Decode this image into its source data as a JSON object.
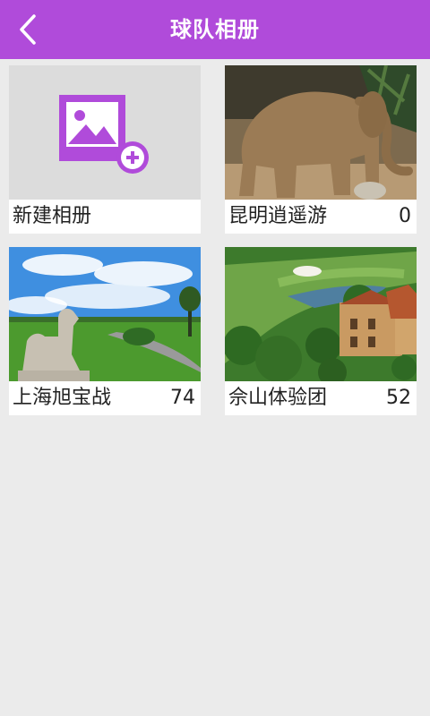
{
  "header": {
    "title": "球队相册",
    "back_icon": "back-chevron-icon",
    "background": "#b04bda"
  },
  "albums": [
    {
      "name": "新建相册",
      "count": "",
      "thumb": "add-image-icon"
    },
    {
      "name": "昆明逍遥游",
      "count": "0",
      "thumb": "elephant-photo"
    },
    {
      "name": "上海旭宝战",
      "count": "74",
      "thumb": "golf-statue-photo"
    },
    {
      "name": "佘山体验团",
      "count": "52",
      "thumb": "golf-course-aerial-photo"
    }
  ]
}
